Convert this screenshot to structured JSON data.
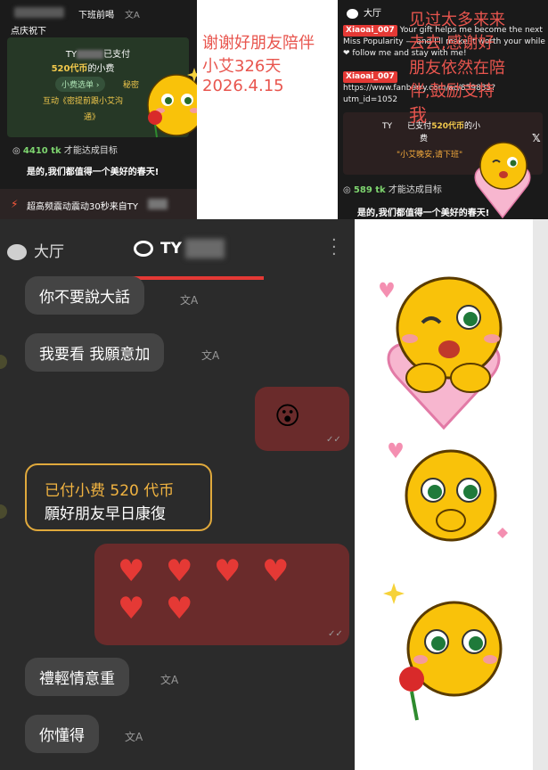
{
  "top_left": {
    "header_title": "下班前喝",
    "header_translate": "文A",
    "subtitle": "点庆祝下",
    "gift_line_prefix": "TY",
    "gift_line_mid": "已支付",
    "gift_amount": "520代币",
    "gift_suffix": "的小费",
    "tip_pill": "小费选单 ›",
    "secret": "秘密",
    "interaction": "互动《密提前跟小艾沟",
    "interaction_end": "通》",
    "goal_amount": "4410 tk",
    "goal_text": " 才能达成目标",
    "quote": "是的,我们都值得一个美好的春天!",
    "bottom_bolt": "⚡",
    "bottom_text": "超高频震动震动30秒来自TY"
  },
  "top_middle": {
    "line1": "谢谢好朋友陪伴",
    "line2": "小艾326天",
    "line3": "2026.4.15"
  },
  "top_right": {
    "hall": "大厅",
    "tag1": "Xiaoai_007",
    "msg1": "Your gift helps me become the next Miss Popularity — and I'll make it worth your while ❤ follow me and stay with me!",
    "tag2": "Xiaoai_007",
    "msg2": "https://www.fanberry.com/ac/859835?utm_id=1052",
    "gift_prefix": "TY",
    "gift_mid": "已支付",
    "gift_amount": "520代币",
    "gift_suffix": "的小",
    "gift_line2": "费",
    "gift_line3": "\"小艾晚安,请下班\"",
    "goal_amount": "589 tk",
    "goal_text": " 才能达成目标",
    "quote": "是的,我们都值得一个美好的春天!",
    "overlay_line1": "见过太多来来",
    "overlay_line2": "去去,感谢好",
    "overlay_line3": "朋友依然在陪",
    "overlay_line4": "伴,鼓励支持",
    "overlay_line5": "我",
    "x_icon": "𝕏"
  },
  "chat": {
    "tab_hall": "大厅",
    "tab_user": "TY",
    "messages": [
      {
        "text": "你不要說大話"
      },
      {
        "text": "我要看 我願意加"
      },
      {
        "text": "😮"
      },
      {
        "gift_line1": "已付小费 520 代币",
        "gift_line2": "願好朋友早日康復"
      },
      {
        "hearts": "♥♥♥♥♥♥"
      },
      {
        "text": "禮輕情意重"
      },
      {
        "text": "你懂得"
      }
    ],
    "translate_icon": "文A",
    "read_check": "✓✓"
  }
}
